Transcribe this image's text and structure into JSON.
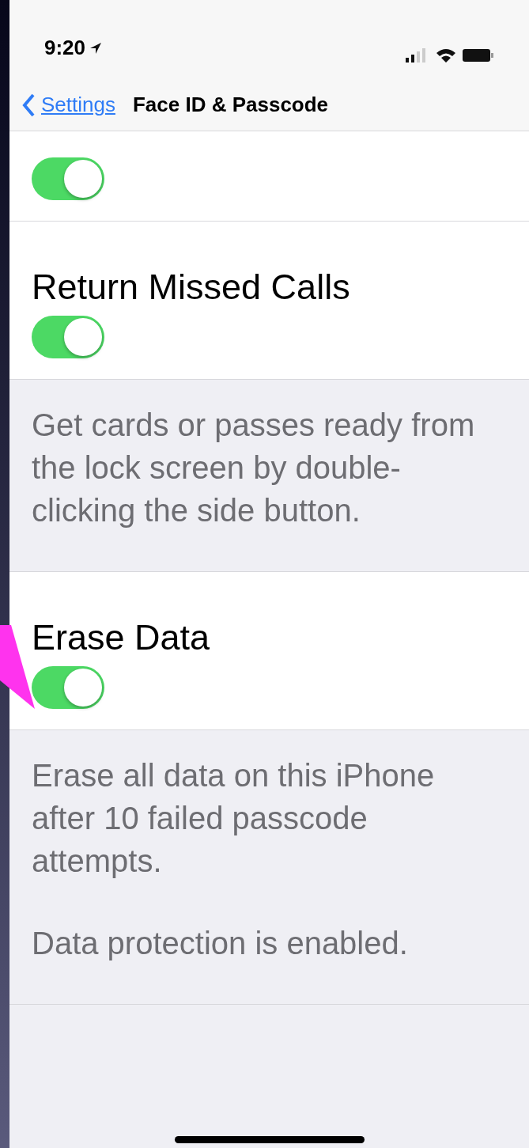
{
  "status_bar": {
    "time": "9:20"
  },
  "nav_bar": {
    "back": "Settings",
    "title": "Face ID & Passcode"
  },
  "sections": [
    {
      "kind": "toggle",
      "on": true
    },
    {
      "kind": "toggle",
      "label": "Return Missed Calls",
      "on": true
    },
    {
      "kind": "footer",
      "lines": [
        "Get cards or passes ready from the lock screen by double-clicking the side button."
      ]
    },
    {
      "kind": "toggle",
      "label": "Erase Data",
      "on": true,
      "annotated": true
    },
    {
      "kind": "footer",
      "lines": [
        "Erase all data on this iPhone after 10 failed passcode attempts.",
        "Data protection is enabled."
      ]
    }
  ]
}
